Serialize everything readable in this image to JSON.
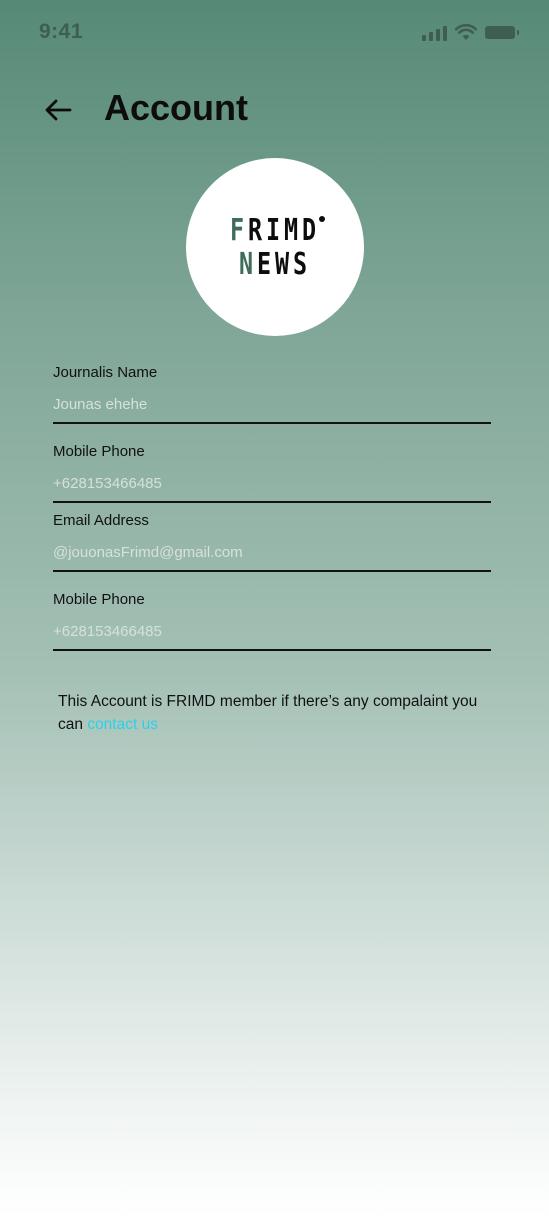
{
  "status": {
    "time": "9:41",
    "signal_icon": "signal-icon",
    "wifi_icon": "wifi-icon",
    "battery_icon": "battery-icon"
  },
  "header": {
    "title": "Account",
    "back_icon": "arrow-left-icon"
  },
  "logo": {
    "line1": "FRIMD",
    "line2": "NEWS"
  },
  "fields": [
    {
      "label": "Journalis Name",
      "value": "Jounas ehehe"
    },
    {
      "label": "Mobile Phone",
      "value": "+628153466485"
    },
    {
      "label": "Email Address",
      "value": "@jouonasFrimd@gmail.com"
    },
    {
      "label": "Mobile Phone",
      "value": "+628153466485"
    }
  ],
  "note": {
    "text": "This Account is FRIMD member if there’s any compalaint you can",
    "link": "contact us"
  },
  "colors": {
    "gradient_top": "#568a76",
    "gradient_bottom": "#ffffff",
    "link": "#2fd0e6",
    "logo_green": "#3f6d5a"
  }
}
